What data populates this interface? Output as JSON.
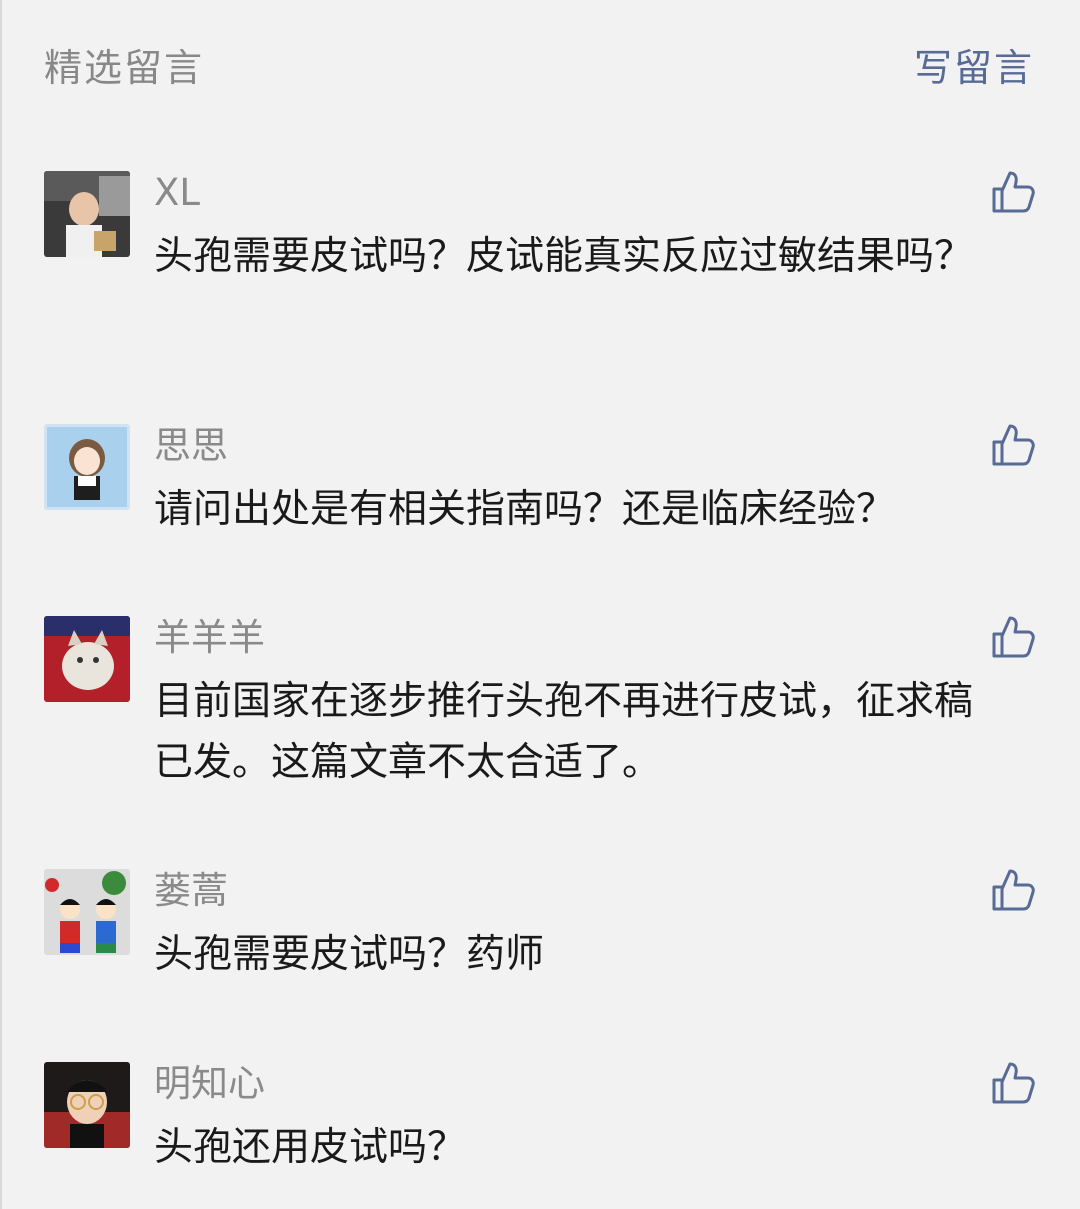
{
  "header": {
    "title": "精选留言",
    "write_label": "写留言"
  },
  "colors": {
    "background": "#f2f2f2",
    "link": "#576b95",
    "muted": "#8a8a8a",
    "text": "#1a1a1a"
  },
  "comments": [
    {
      "nickname": "XL",
      "content": "头孢需要皮试吗？皮试能真实反应过敏结果吗？",
      "avatar_icon": "baby-in-car-avatar"
    },
    {
      "nickname": "思思",
      "content": "请问出处是有相关指南吗？还是临床经验？",
      "avatar_icon": "cartoon-girl-avatar"
    },
    {
      "nickname": "羊羊羊",
      "content": "目前国家在逐步推行头孢不再进行皮试，征求稿已发。这篇文章不太合适了。",
      "avatar_icon": "cat-avatar"
    },
    {
      "nickname": "蒌蒿",
      "content": "头孢需要皮试吗？药师",
      "avatar_icon": "cartoon-kids-avatar"
    },
    {
      "nickname": "明知心",
      "content": "头孢还用皮试吗？",
      "avatar_icon": "child-with-glasses-avatar"
    }
  ]
}
